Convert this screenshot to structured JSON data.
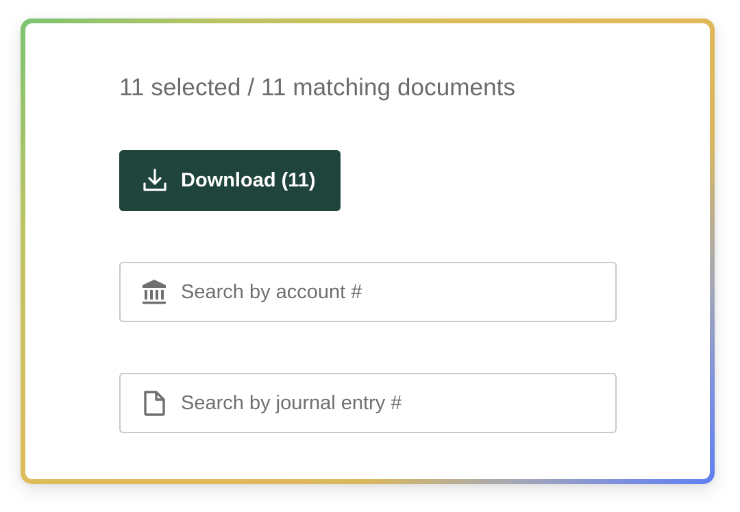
{
  "summary": {
    "text": "11 selected / 11 matching documents"
  },
  "download": {
    "label": "Download (11)",
    "icon": "download-icon",
    "color": "#1f443b"
  },
  "search_account": {
    "placeholder": "Search by account #",
    "value": "",
    "icon": "bank-icon"
  },
  "search_journal": {
    "placeholder": "Search by journal entry #",
    "value": "",
    "icon": "document-icon"
  },
  "colors": {
    "text_muted": "#6b6b6b",
    "border": "#c9c9c9",
    "frame_gradient": [
      "#7cc471",
      "#ddbd5b",
      "#e2b85a",
      "#5f7ff0"
    ]
  }
}
